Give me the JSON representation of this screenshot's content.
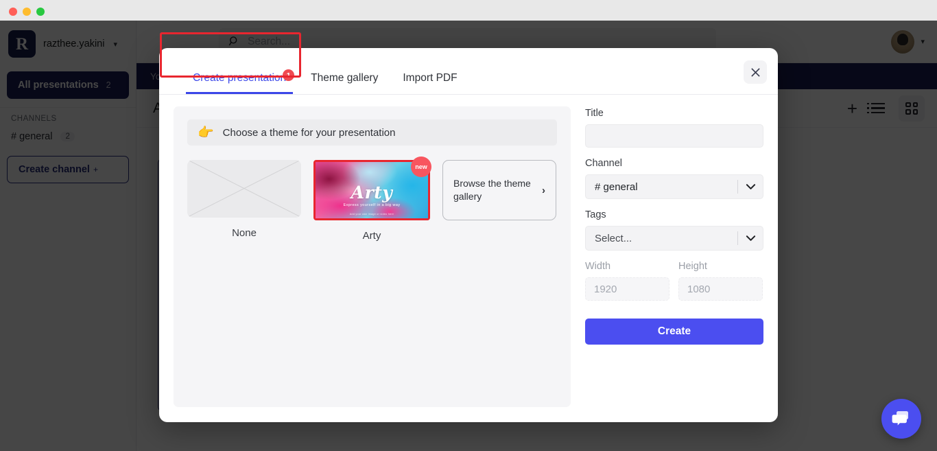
{
  "window": {
    "traffic_lights": [
      "close",
      "minimize",
      "maximize"
    ]
  },
  "app": {
    "sidebar": {
      "workspace": {
        "logo_letter": "R",
        "name": "razthee.yakini",
        "caret_icon": "chevron-down-icon"
      },
      "nav_active": {
        "label": "All presentations",
        "count": "2"
      },
      "section_label": "CHANNELS",
      "channels": [
        {
          "label": "# general",
          "count": "2"
        }
      ],
      "create_channel": {
        "label": "Create channel",
        "plus": "+"
      }
    },
    "topbar": {
      "search_placeholder": "Search...",
      "search_icon": "search-icon",
      "avatar_caret_icon": "chevron-down-icon"
    },
    "banner": {
      "text": "You"
    },
    "content": {
      "title": "A",
      "tools": [
        "add-icon",
        "list-view-icon",
        "grid-view-icon"
      ]
    },
    "fab": {
      "icon": "chat-bubble-icon",
      "color": "#4b4ef0"
    }
  },
  "modal": {
    "tabs": [
      {
        "label": "Create presentation",
        "active": true,
        "badge": "1"
      },
      {
        "label": "Theme gallery",
        "active": false
      },
      {
        "label": "Import PDF",
        "active": false
      }
    ],
    "close_icon": "close-icon",
    "highlight_color": "#e8262f",
    "accent_color": "#3b46e8",
    "hint": {
      "emoji": "👉",
      "text": "Choose a theme for your presentation"
    },
    "themes": [
      {
        "name": "None",
        "type": "none",
        "selected": false
      },
      {
        "name": "Arty",
        "type": "image",
        "selected": true,
        "badge": "new",
        "art_title": "Arty",
        "art_subtitle": "Express yourself in a big way",
        "art_footer": "Add your own image or video here"
      }
    ],
    "browse": {
      "label": "Browse the theme gallery",
      "chevron_icon": "chevron-right-icon"
    },
    "form": {
      "title": {
        "label": "Title",
        "value": "",
        "placeholder": ""
      },
      "channel": {
        "label": "Channel",
        "value": "# general",
        "caret_icon": "chevron-down-icon"
      },
      "tags": {
        "label": "Tags",
        "value": "Select...",
        "caret_icon": "chevron-down-icon"
      },
      "width": {
        "label": "Width",
        "placeholder": "1920",
        "value": ""
      },
      "height": {
        "label": "Height",
        "placeholder": "1080",
        "value": ""
      },
      "submit": {
        "label": "Create",
        "color": "#4b4ef0"
      }
    }
  }
}
